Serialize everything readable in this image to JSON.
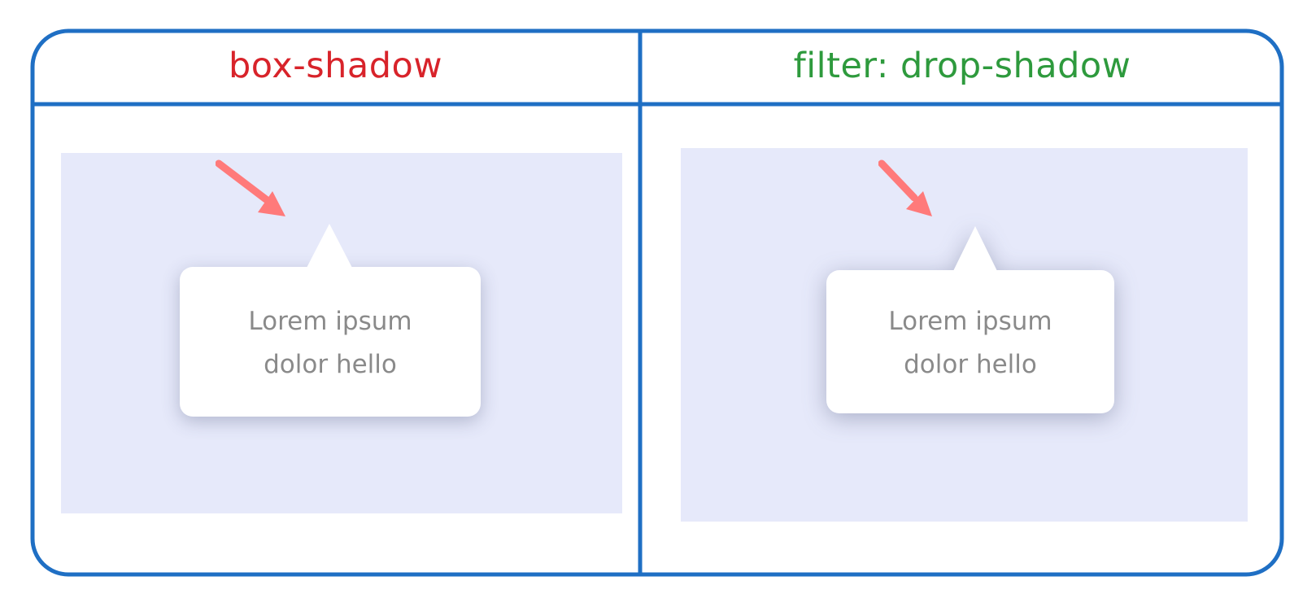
{
  "columns": [
    {
      "heading": "box-shadow",
      "bubble_line1": "Lorem ipsum",
      "bubble_line2": "dolor hello"
    },
    {
      "heading": "filter: drop-shadow",
      "bubble_line1": "Lorem ipsum",
      "bubble_line2": "dolor hello"
    }
  ],
  "colors": {
    "frame": "#1f6fc4",
    "heading_left": "#d8232a",
    "heading_right": "#2e9a3d",
    "stage_bg": "#e6e9fa",
    "arrow": "#ff7a7a",
    "bubble_text": "#8a8a8a"
  },
  "icons": {
    "arrow": "pointer-arrow-icon"
  }
}
